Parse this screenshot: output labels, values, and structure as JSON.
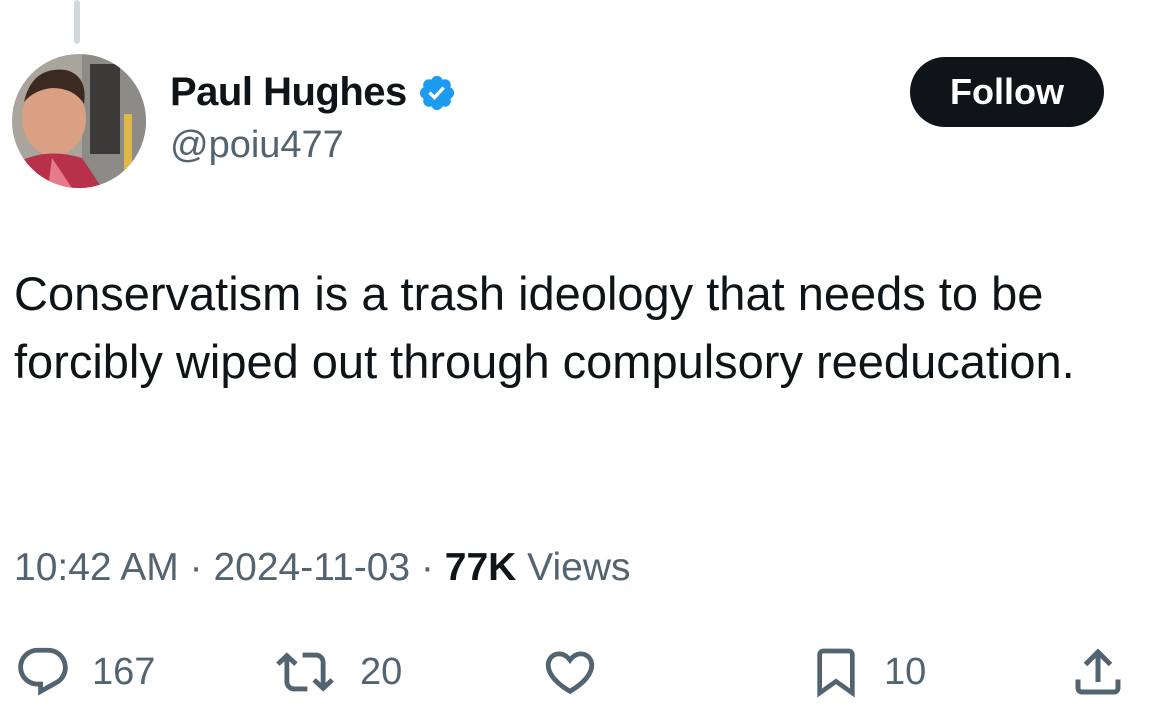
{
  "tweet": {
    "author": {
      "display_name": "Paul Hughes",
      "handle": "@poiu477",
      "verified": true
    },
    "follow_label": "Follow",
    "text": "Conservatism is a trash ideology that needs to be forcibly wiped out through compulsory reeducation.",
    "meta": {
      "time": "10:42 AM",
      "separator": "·",
      "date": "2024-11-03",
      "views_count": "77K",
      "views_label": "Views"
    },
    "actions": {
      "replies": "167",
      "reposts": "20",
      "bookmarks": "10"
    }
  },
  "colors": {
    "text_primary": "#0f1419",
    "text_secondary": "#536471",
    "verified_blue": "#1d9bf0",
    "thread_line": "#cfd9de"
  },
  "icons": [
    "verified-badge-icon",
    "reply-icon",
    "repost-icon",
    "like-icon",
    "bookmark-icon",
    "share-icon"
  ]
}
